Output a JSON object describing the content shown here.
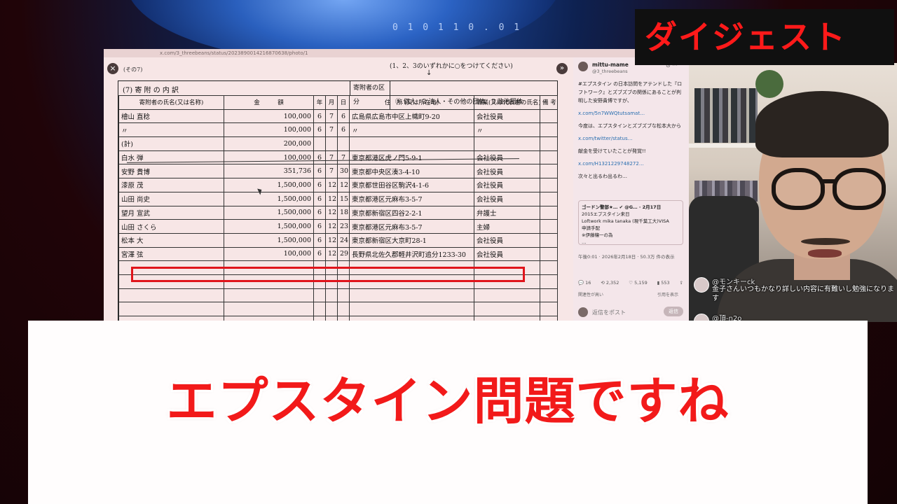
{
  "overlay": {
    "badge": "ダイジェスト",
    "caption": "エプスタイン問題ですね"
  },
  "background": {
    "globe_digits": "0 1 0 1 1 0 . 0 1"
  },
  "browser": {
    "url": "x.com/3_threebeans/status/2023890014216870638/photo/1",
    "close_icon": "×",
    "next_icon": "»"
  },
  "document": {
    "note": "(その7)",
    "instruction": "(1、2、3のいずれかに○をつけてください)",
    "arrow": "↓",
    "section_title": "(7) 寄 附 の 内 訳",
    "classification_label": "寄附者の区分",
    "classification_options": "①.個人　2.法人・その他の団体　3.政治団体",
    "headers": {
      "name": "寄附者の氏名(又は名称)",
      "amount": "金　　　額",
      "year": "年",
      "month": "月",
      "day": "日",
      "address": "住　所 (又は所在地)",
      "occupation": "職業(又は代表者の氏名)",
      "remarks": "備 考"
    },
    "rows": [
      {
        "name": "檜山 直稔",
        "amount": "100,000",
        "y": "6",
        "m": "7",
        "d": "6",
        "address": "広島県広島市中区上幟町9-20",
        "occupation": "会社役員"
      },
      {
        "name": "〃",
        "amount": "100,000",
        "y": "6",
        "m": "7",
        "d": "6",
        "address": "〃",
        "occupation": "〃"
      },
      {
        "name": "(計)",
        "amount": "200,000",
        "y": "",
        "m": "",
        "d": "",
        "address": "",
        "occupation": ""
      },
      {
        "name": "白水 弾",
        "amount": "100,000",
        "y": "6",
        "m": "7",
        "d": "7",
        "address": "東京都港区虎ノ門5-9-1",
        "occupation": "会社役員"
      },
      {
        "name": "安野 貴博",
        "amount": "351,736",
        "y": "6",
        "m": "7",
        "d": "30",
        "address": "東京都中央区湊3-4-10",
        "occupation": "会社役員"
      },
      {
        "name": "漆原 茂",
        "amount": "1,500,000",
        "y": "6",
        "m": "12",
        "d": "12",
        "address": "東京都世田谷区駒沢4-1-6",
        "occupation": "会社役員"
      },
      {
        "name": "山田 尚史",
        "amount": "1,500,000",
        "y": "6",
        "m": "12",
        "d": "15",
        "address": "東京都港区元麻布3-5-7",
        "occupation": "会社役員"
      },
      {
        "name": "望月 宣武",
        "amount": "1,500,000",
        "y": "6",
        "m": "12",
        "d": "18",
        "address": "東京都新宿区四谷2-2-1",
        "occupation": "弁護士"
      },
      {
        "name": "山田 さくら",
        "amount": "1,500,000",
        "y": "6",
        "m": "12",
        "d": "23",
        "address": "東京都港区元麻布3-5-7",
        "occupation": "主婦"
      },
      {
        "name": "松本 大",
        "amount": "1,500,000",
        "y": "6",
        "m": "12",
        "d": "24",
        "address": "東京都新宿区大京町28-1",
        "occupation": "会社役員"
      },
      {
        "name": "宮澤 弦",
        "amount": "100,000",
        "y": "6",
        "m": "12",
        "d": "29",
        "address": "長野県北佐久郡軽井沢町追分1233-30",
        "occupation": "会社役員"
      },
      {
        "name": "",
        "amount": "",
        "y": "",
        "m": "",
        "d": "",
        "address": "",
        "occupation": ""
      },
      {
        "name": "",
        "amount": "",
        "y": "",
        "m": "",
        "d": "",
        "address": "",
        "occupation": ""
      },
      {
        "name": "",
        "amount": "",
        "y": "",
        "m": "",
        "d": "",
        "address": "",
        "occupation": ""
      },
      {
        "name": "",
        "amount": "",
        "y": "",
        "m": "",
        "d": "",
        "address": "",
        "occupation": ""
      },
      {
        "name": "",
        "amount": "",
        "y": "",
        "m": "",
        "d": "",
        "address": "",
        "occupation": ""
      }
    ]
  },
  "tweet": {
    "name": "mittu-mame",
    "handle": "@3_threebeans",
    "icons": "⊙  ···",
    "p1": "#エプスタイン の日本訪問をアテンドした『ロフトワーク』とズブズブの関係にあることが判明した安野貴博ですが、",
    "link1": "x.com/5n7WWQtutsamat…",
    "p2": "今度は、エプスタインとズブズブな松本大から",
    "link2": "x.com/twitter/status…",
    "p3": "献金を受けていたことが発覚!!",
    "link3": "x.com/H1321229748272…",
    "p4": "次々と出るわ出るわ…",
    "quote_author": "ゴードン警部★… ✔ @G… · 2月17日",
    "quote_l1": "2015エプスタイン来日",
    "quote_l2": "Loftwork mika tanaka (現千葉工大)VISA",
    "quote_l3": "申請手配",
    "quote_l4": "※伊藤穰一の為",
    "quote_l5": "…",
    "time": "午後0:01 · 2026年2月18日 · 50.3万 件の表示",
    "stat_replies": "16",
    "stat_retweets": "2,352",
    "stat_likes": "5,159",
    "stat_bookmarks": "553",
    "related": "関連性が高い",
    "quote_view": "引用を表示",
    "reply_placeholder": "返信をポスト",
    "reply_button": "返信"
  },
  "comments": [
    {
      "user": "@モンキーck",
      "text": "金子さんいつもかなり詳しい内容に有難いし勉強になります"
    },
    {
      "user": "@頂-n2o",
      "text": ""
    }
  ]
}
